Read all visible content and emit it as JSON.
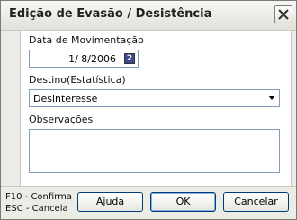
{
  "window": {
    "title": "Edição de Evasão / Desistência"
  },
  "form": {
    "date_label": "Data de Movimentação",
    "date_value": "1/ 8/2006",
    "destino_label": "Destino(Estatística)",
    "destino_value": "Desinteresse",
    "obs_label": "Observações",
    "obs_value": ""
  },
  "footer": {
    "hint_confirm": "F10 - Confirma",
    "hint_cancel": "ESC - Cancela",
    "help_label": "Ajuda",
    "ok_label": "OK",
    "cancel_label": "Cancelar"
  },
  "icons": {
    "close": "close-icon",
    "calendar": "calendar-icon",
    "dropdown": "chevron-down-icon"
  },
  "colors": {
    "field_border": "#7f9db9",
    "button_border": "#003c74",
    "background": "#ecece6"
  }
}
